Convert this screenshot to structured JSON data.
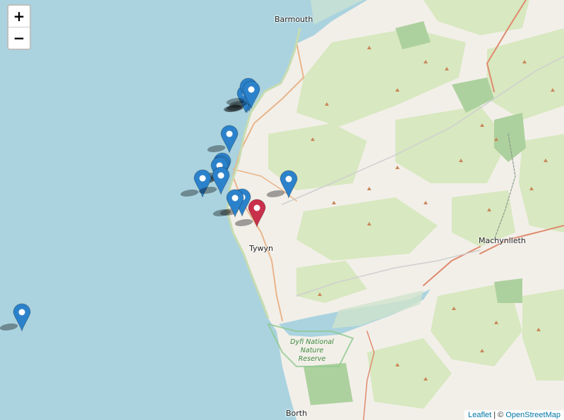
{
  "controls": {
    "zoom_in": "+",
    "zoom_out": "−"
  },
  "places": [
    {
      "id": "barmouth",
      "label": "Barmouth"
    },
    {
      "id": "tywyn",
      "label": "Tywyn"
    },
    {
      "id": "machynlleth",
      "label": "Machynlleth"
    },
    {
      "id": "borth",
      "label": "Borth"
    }
  ],
  "reserve_label": [
    "Dyfi National",
    "Nature",
    "Reserve"
  ],
  "attribution": {
    "leaflet": "Leaflet",
    "separator": "| ©",
    "osm": "OpenStreetMap"
  },
  "marker_colors": {
    "default": "#2b82cb",
    "highlighted": "#c9304b"
  },
  "markers": {
    "blue_count": 15,
    "red_count": 1
  }
}
